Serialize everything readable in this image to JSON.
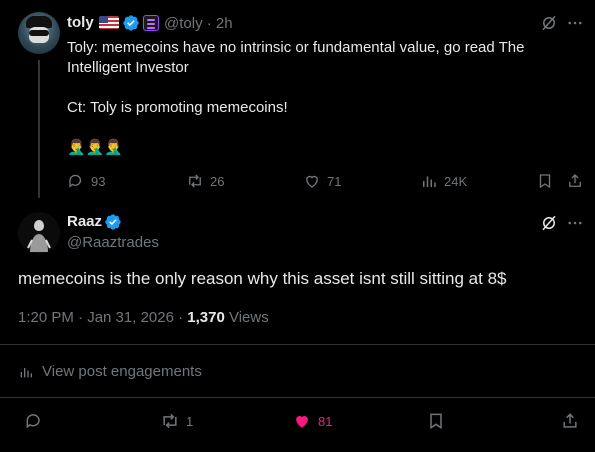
{
  "parent": {
    "name": "toly",
    "handle": "@toly",
    "time": "2h",
    "separator": "·",
    "text": "Toly: memecoins have no intrinsic or fundamental value, go read The Intelligent Investor\n\nCt: Toly is promoting memecoins!\n\n🤦‍♂️🤦‍♂️🤦‍♂️",
    "actions": {
      "replies": "93",
      "reposts": "26",
      "likes": "71",
      "views": "24K"
    }
  },
  "tweet": {
    "name": "Raaz",
    "handle": "@Raaztrades",
    "text": "memecoins is the only reason why this asset isnt still sitting at 8$",
    "timestamp": "1:20 PM · Jan 31, 2026 · ",
    "views_count": "1,370",
    "views_label": " Views",
    "engagements_label": "View post engagements",
    "actions": {
      "reposts": "1",
      "likes": "81"
    }
  },
  "colors": {
    "like_active": "#f91880",
    "verified": "#1d9bf0",
    "muted": "#71767b"
  }
}
